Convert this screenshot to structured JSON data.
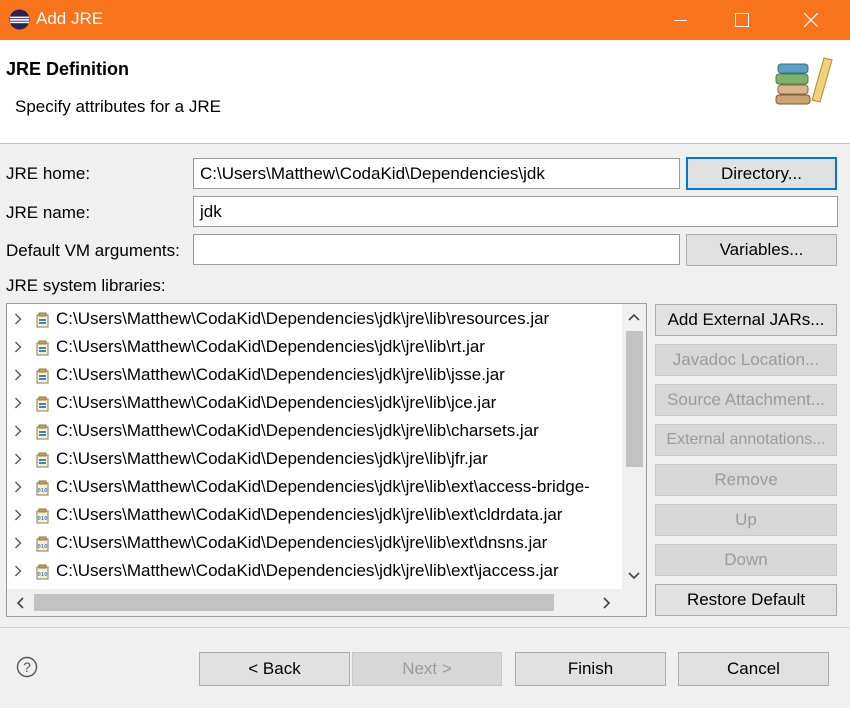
{
  "window": {
    "title": "Add JRE",
    "accent_color": "#f8731c"
  },
  "header": {
    "title": "JRE Definition",
    "subtitle": "Specify attributes for a JRE",
    "banner_icon": "books-icon"
  },
  "form": {
    "jre_home_label": "JRE home:",
    "jre_home_value": "C:\\Users\\Matthew\\CodaKid\\Dependencies\\jdk",
    "directory_button": "Directory...",
    "jre_name_label": "JRE name:",
    "jre_name_value": "jdk",
    "vm_args_label": "Default VM arguments:",
    "vm_args_value": "",
    "variables_button": "Variables...",
    "system_libs_label": "JRE system libraries:"
  },
  "libraries": [
    "C:\\Users\\Matthew\\CodaKid\\Dependencies\\jdk\\jre\\lib\\resources.jar",
    "C:\\Users\\Matthew\\CodaKid\\Dependencies\\jdk\\jre\\lib\\rt.jar",
    "C:\\Users\\Matthew\\CodaKid\\Dependencies\\jdk\\jre\\lib\\jsse.jar",
    "C:\\Users\\Matthew\\CodaKid\\Dependencies\\jdk\\jre\\lib\\jce.jar",
    "C:\\Users\\Matthew\\CodaKid\\Dependencies\\jdk\\jre\\lib\\charsets.jar",
    "C:\\Users\\Matthew\\CodaKid\\Dependencies\\jdk\\jre\\lib\\jfr.jar",
    "C:\\Users\\Matthew\\CodaKid\\Dependencies\\jdk\\jre\\lib\\ext\\access-bridge-",
    "C:\\Users\\Matthew\\CodaKid\\Dependencies\\jdk\\jre\\lib\\ext\\cldrdata.jar",
    "C:\\Users\\Matthew\\CodaKid\\Dependencies\\jdk\\jre\\lib\\ext\\dnsns.jar",
    "C:\\Users\\Matthew\\CodaKid\\Dependencies\\jdk\\jre\\lib\\ext\\jaccess.jar"
  ],
  "library_buttons": {
    "add_external_jars": "Add External JARs...",
    "javadoc_location": "Javadoc Location...",
    "source_attachment": "Source Attachment...",
    "external_annotations": "External annotations...",
    "remove": "Remove",
    "up": "Up",
    "down": "Down",
    "restore_default": "Restore Default"
  },
  "footer": {
    "back": "< Back",
    "next": "Next >",
    "finish": "Finish",
    "cancel": "Cancel"
  }
}
